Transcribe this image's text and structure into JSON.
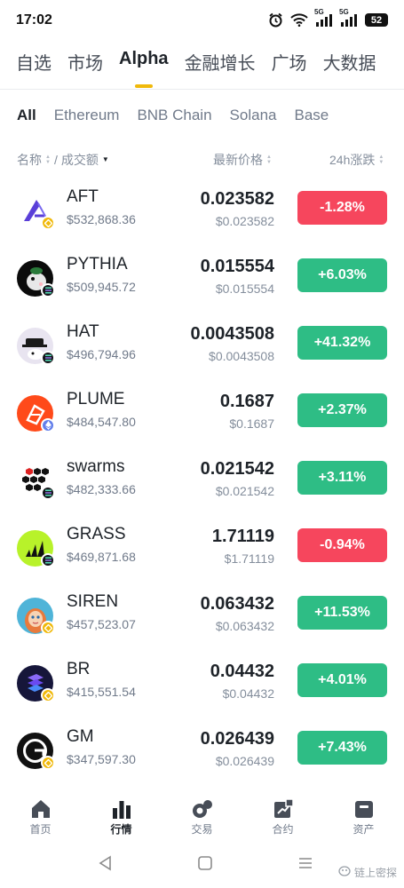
{
  "status": {
    "time": "17:02",
    "signal1": "5G",
    "signal2": "5G",
    "battery": "52"
  },
  "main_tabs": [
    {
      "label": "自选",
      "active": false
    },
    {
      "label": "市场",
      "active": false
    },
    {
      "label": "Alpha",
      "active": true
    },
    {
      "label": "金融增长",
      "active": false
    },
    {
      "label": "广场",
      "active": false
    },
    {
      "label": "大数据",
      "active": false
    }
  ],
  "chain_tabs": [
    {
      "label": "All",
      "active": true
    },
    {
      "label": "Ethereum",
      "active": false
    },
    {
      "label": "BNB Chain",
      "active": false
    },
    {
      "label": "Solana",
      "active": false
    },
    {
      "label": "Base",
      "active": false
    }
  ],
  "headers": {
    "name": "名称",
    "sep": "/",
    "volume": "成交额",
    "price": "最新价格",
    "change": "24h涨跌"
  },
  "rows": [
    {
      "symbol": "AFT",
      "volume": "$532,868.36",
      "price": "0.023582",
      "usd": "$0.023582",
      "change": "-1.28%",
      "dir": "down",
      "chain": "bnb",
      "logo": "aft-logo"
    },
    {
      "symbol": "PYTHIA",
      "volume": "$509,945.72",
      "price": "0.015554",
      "usd": "$0.015554",
      "change": "+6.03%",
      "dir": "up",
      "chain": "sol",
      "logo": "pythia-logo"
    },
    {
      "symbol": "HAT",
      "volume": "$496,794.96",
      "price": "0.0043508",
      "usd": "$0.0043508",
      "change": "+41.32%",
      "dir": "up",
      "chain": "sol",
      "logo": "hat-logo"
    },
    {
      "symbol": "PLUME",
      "volume": "$484,547.80",
      "price": "0.1687",
      "usd": "$0.1687",
      "change": "+2.37%",
      "dir": "up",
      "chain": "eth",
      "logo": "plume-logo"
    },
    {
      "symbol": "swarms",
      "volume": "$482,333.66",
      "price": "0.021542",
      "usd": "$0.021542",
      "change": "+3.11%",
      "dir": "up",
      "chain": "sol",
      "logo": "swarms-logo"
    },
    {
      "symbol": "GRASS",
      "volume": "$469,871.68",
      "price": "1.71119",
      "usd": "$1.71119",
      "change": "-0.94%",
      "dir": "down",
      "chain": "sol",
      "logo": "grass-logo"
    },
    {
      "symbol": "SIREN",
      "volume": "$457,523.07",
      "price": "0.063432",
      "usd": "$0.063432",
      "change": "+11.53%",
      "dir": "up",
      "chain": "bnb",
      "logo": "siren-logo"
    },
    {
      "symbol": "BR",
      "volume": "$415,551.54",
      "price": "0.04432",
      "usd": "$0.04432",
      "change": "+4.01%",
      "dir": "up",
      "chain": "bnb",
      "logo": "br-logo"
    },
    {
      "symbol": "GM",
      "volume": "$347,597.30",
      "price": "0.026439",
      "usd": "$0.026439",
      "change": "+7.43%",
      "dir": "up",
      "chain": "bnb",
      "logo": "gm-logo"
    }
  ],
  "bottom_nav": [
    {
      "label": "首页",
      "icon": "home-icon",
      "active": false
    },
    {
      "label": "行情",
      "icon": "markets-icon",
      "active": true
    },
    {
      "label": "交易",
      "icon": "trade-icon",
      "active": false
    },
    {
      "label": "合约",
      "icon": "futures-icon",
      "active": false
    },
    {
      "label": "资产",
      "icon": "wallet-icon",
      "active": false
    }
  ],
  "watermark": "链上密探",
  "colors": {
    "accent": "#f0b90b",
    "up": "#2ebd85",
    "down": "#f6465d"
  }
}
